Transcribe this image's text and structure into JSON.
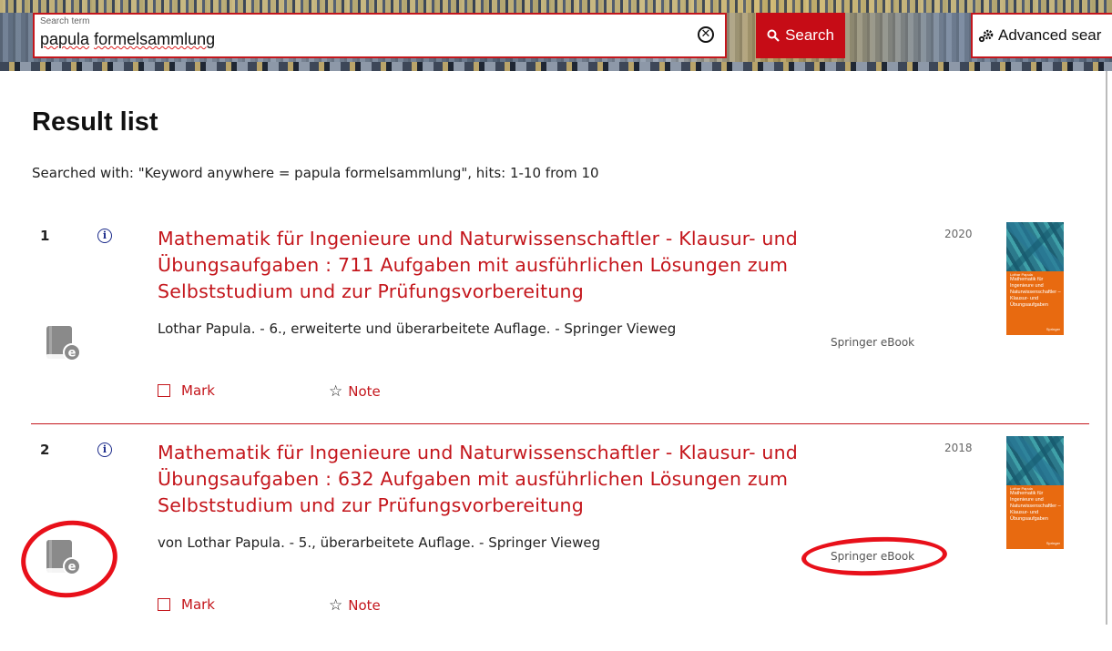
{
  "search": {
    "label": "Search term",
    "query_part1": "papula",
    "query_part2": "formelsammlung",
    "button_label": "Search",
    "advanced_label": "Advanced sear"
  },
  "page": {
    "title": "Result list",
    "search_info": "Searched with: \"Keyword anywhere = papula formelsammlung\", hits: 1-10 from 10"
  },
  "results": [
    {
      "number": "1",
      "title": "Mathematik für Ingenieure und Naturwissenschaftler - Klausur- und Übungsaufgaben : 711 Aufgaben mit ausführlichen Lösungen zum Selbststudium und zur Prüfungsvorbereitung",
      "year": "2020",
      "meta": "Lothar Papula. - 6., erweiterte und überarbeitete Auflage. - Springer Vieweg",
      "format": "Springer eBook",
      "mark_label": "Mark",
      "note_label": "Note"
    },
    {
      "number": "2",
      "title": "Mathematik für Ingenieure und Naturwissenschaftler - Klausur- und Übungsaufgaben : 632 Aufgaben mit ausführlichen Lösungen zum Selbststudium und zur Prüfungsvorbereitung",
      "year": "2018",
      "meta": "von Lothar Papula. - 5., überarbeitete Auflage. - Springer Vieweg",
      "format": "Springer eBook",
      "mark_label": "Mark",
      "note_label": "Note"
    }
  ],
  "icons": {
    "clear": "clear-search-icon",
    "search": "magnifier-icon",
    "advanced": "gear-icon",
    "info": "info-icon",
    "ebook": "ebook-icon",
    "star": "star-icon"
  },
  "colors": {
    "accent": "#c4161c",
    "annotation": "#e8101a"
  }
}
